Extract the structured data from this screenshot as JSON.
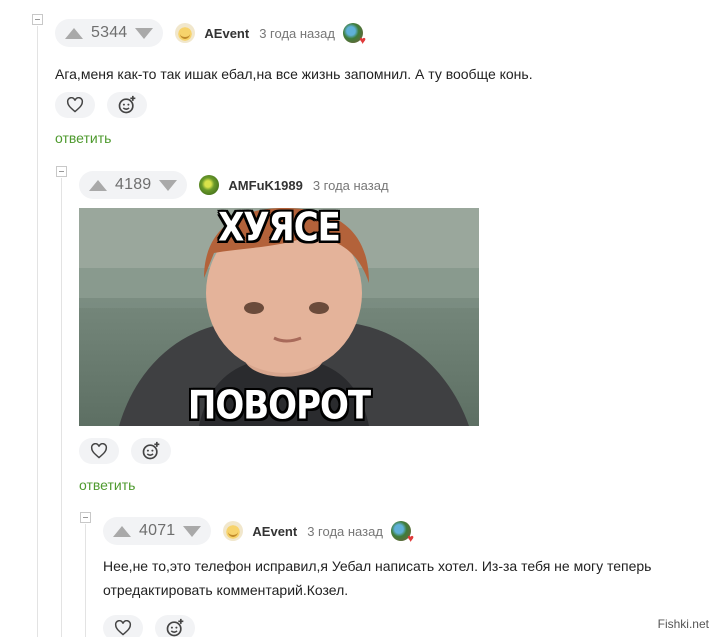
{
  "comments": [
    {
      "rating": "5344",
      "username": "AEvent",
      "time": "3 года назад",
      "text": "Ага,меня как-то так ишак ебал,на все жизнь запомнил. А ту вообще конь.",
      "reply_label": "ответить"
    },
    {
      "rating": "4189",
      "username": "AMFuK1989",
      "time": "3 года назад",
      "image": {
        "top_caption": "ХУЯСЕ",
        "bottom_caption": "ПОВОРОТ"
      },
      "reply_label": "ответить"
    },
    {
      "rating": "4071",
      "username": "AEvent",
      "time": "3 года назад",
      "text": "Нее,не то,это телефон исправил,я Уебал написать хотел. Из-за тебя не могу теперь отредактировать комментарий.Козел."
    }
  ],
  "icons": {
    "upvote": "arrow-up-icon",
    "downvote": "arrow-down-icon",
    "like": "heart-icon",
    "react": "smile-plus-icon",
    "collapse": "minus-box-icon"
  },
  "colors": {
    "reply_link": "#4e9a2e",
    "rating_bg": "#f2f3f5"
  },
  "watermark": "Fishki.net"
}
